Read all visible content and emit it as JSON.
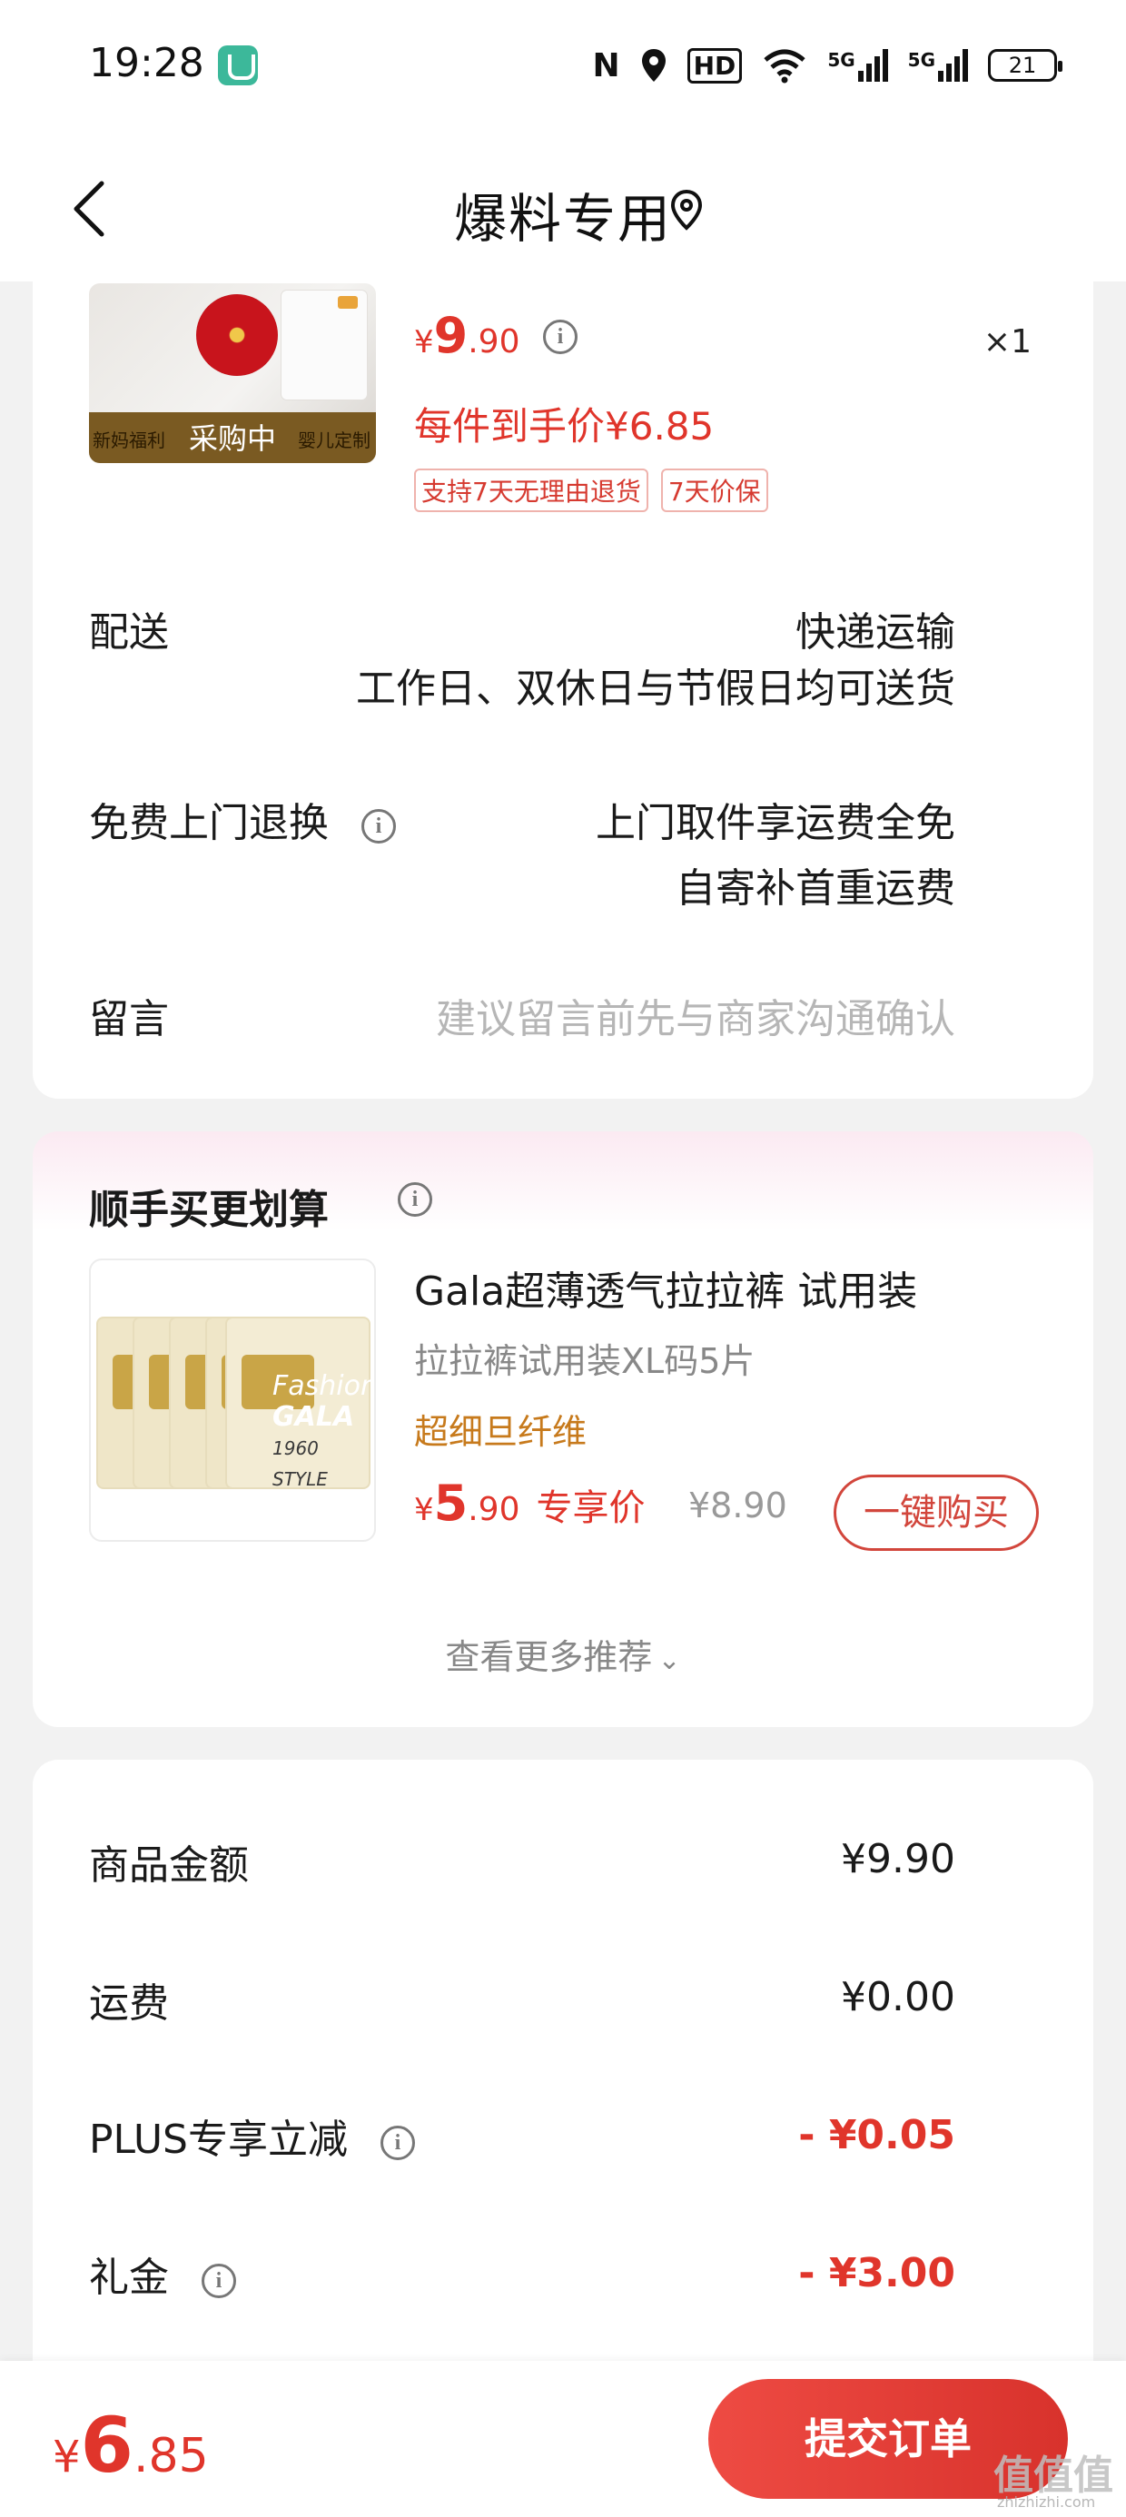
{
  "status_bar": {
    "time": "19:28",
    "nfc": "N",
    "hd": "HD",
    "sig1": "5G",
    "sig2": "5G",
    "battery": "21"
  },
  "nav": {
    "title": "爆料专用"
  },
  "order_item": {
    "thumb_overlay": "采购中",
    "thumb_left": "新妈福利",
    "thumb_right": "婴儿定制",
    "price_symbol": "¥",
    "price_int": "9",
    "price_dec": ".90",
    "quantity": "×1",
    "per_item_price": "每件到手价¥6.85",
    "tags": [
      "支持7天无理由退货",
      "7天价保"
    ]
  },
  "delivery": {
    "label": "配送",
    "method": "快递运输",
    "schedule": "工作日、双休日与节假日均可送货"
  },
  "return_service": {
    "label": "免费上门退换",
    "line1": "上门取件享运费全免",
    "line2": "自寄补首重运费"
  },
  "message": {
    "label": "留言",
    "placeholder": "建议留言前先与商家沟通确认"
  },
  "addon": {
    "title": "顺手买更划算",
    "product": {
      "pack_line1": "Fashion",
      "pack_line2": "GALA",
      "pack_line3": "1960",
      "pack_line4": "STYLE",
      "name": "Gala超薄透气拉拉裤 试用装",
      "spec": "拉拉裤试用装XL码5片",
      "feature": "超细旦纤维",
      "price_symbol": "¥",
      "price_int": "5",
      "price_dec": ".90",
      "price_label": "专享价",
      "original_price": "¥8.90",
      "buy_button": "一键购买"
    },
    "more": "查看更多推荐",
    "more_chevron": "⌄"
  },
  "summary": {
    "rows": [
      {
        "label": "商品金额",
        "value": "¥9.90"
      },
      {
        "label": "运费",
        "value": "¥0.00"
      },
      {
        "label": "PLUS专享立减",
        "value": "- ¥0.05"
      },
      {
        "label": "礼金",
        "value": "- ¥3.00"
      }
    ]
  },
  "bottom": {
    "total_symbol": "¥",
    "total_int": "6",
    "total_dec": ".85",
    "submit": "提交订单"
  },
  "watermark": {
    "text": "值值值",
    "sub": "zhizhizhi.com"
  },
  "colors": {
    "accent_red": "#e0352b",
    "feature_orange": "#c77a1c",
    "muted_gray": "#888888"
  }
}
